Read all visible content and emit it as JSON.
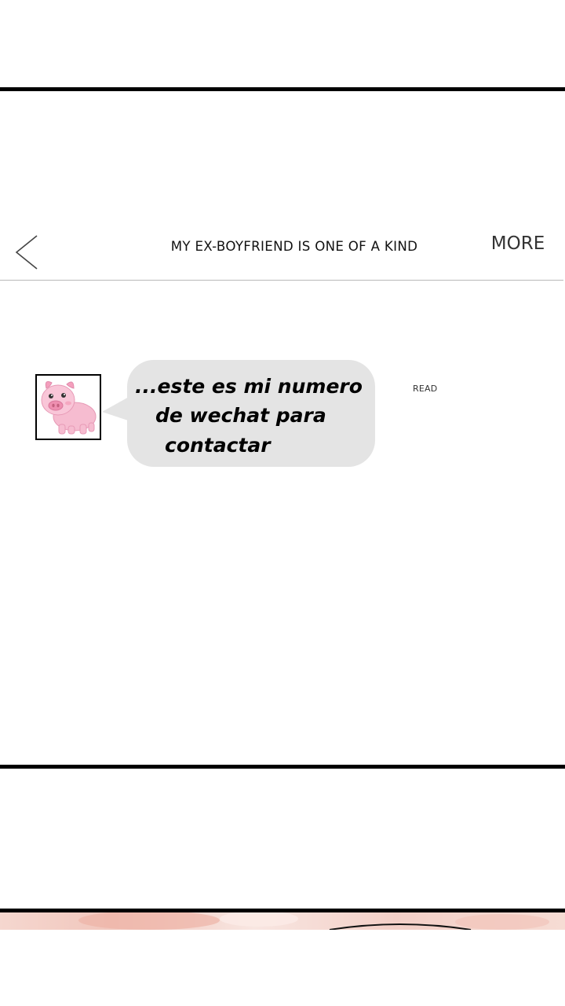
{
  "header": {
    "title": "MY EX-BOYFRIEND IS ONE OF A KIND",
    "more_label": "MORE",
    "back_icon": "chevron-left-icon"
  },
  "chat": {
    "avatar_icon": "pig-avatar-icon",
    "message_lines": [
      "...este es mi numero",
      "de wechat para",
      "contactar"
    ],
    "status": "READ",
    "bubble_color": "#e4e4e4"
  }
}
